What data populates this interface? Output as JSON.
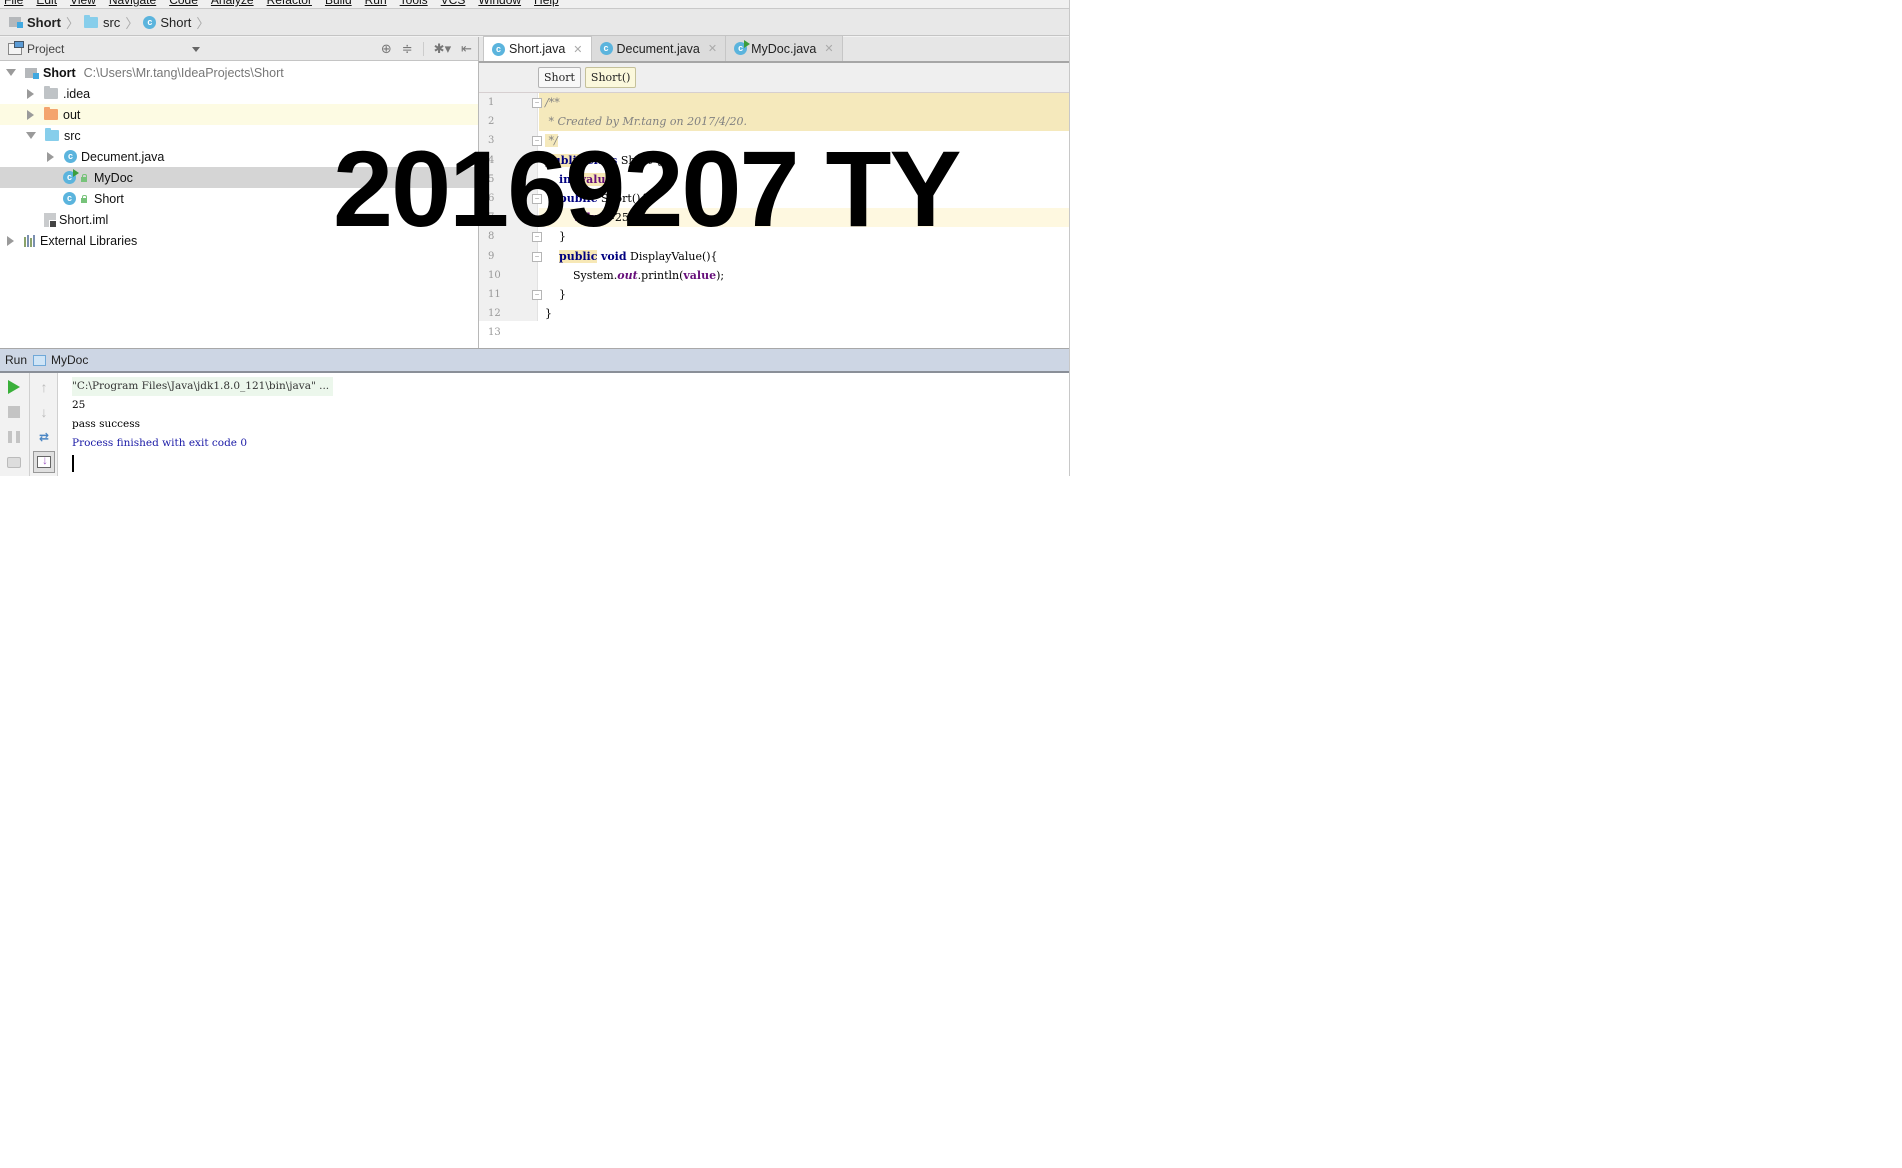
{
  "menu": [
    "File",
    "Edit",
    "View",
    "Navigate",
    "Code",
    "Analyze",
    "Refactor",
    "Build",
    "Run",
    "Tools",
    "VCS",
    "Window",
    "Help"
  ],
  "breadcrumb": [
    {
      "label": "Short",
      "icon": "module-icon"
    },
    {
      "label": "src",
      "icon": "folder-icon"
    },
    {
      "label": "Short",
      "icon": "class-icon"
    }
  ],
  "project_panel": {
    "title": "Project",
    "toolbar_icons": [
      "locate-icon",
      "collapse-all-icon",
      "settings-icon",
      "hide-panel-icon"
    ],
    "tree": [
      {
        "label": "Short",
        "hint": "C:\\Users\\Mr.tang\\IdeaProjects\\Short",
        "icon": "module-icon",
        "expanded": true
      },
      {
        "label": ".idea",
        "icon": "folder-icon",
        "expanded": false
      },
      {
        "label": "out",
        "icon": "folder-excluded-icon",
        "expanded": false
      },
      {
        "label": "src",
        "icon": "source-folder-icon",
        "expanded": true
      },
      {
        "label": "Decument.java",
        "icon": "class-icon",
        "expanded": false
      },
      {
        "label": "MyDoc",
        "icon": "runnable-class-icon",
        "selected": true
      },
      {
        "label": "Short",
        "icon": "class-icon"
      },
      {
        "label": "Short.iml",
        "icon": "iml-file-icon"
      },
      {
        "label": "External Libraries",
        "icon": "libraries-icon",
        "expanded": false
      }
    ]
  },
  "editor": {
    "tabs": [
      {
        "label": "Short.java",
        "active": true
      },
      {
        "label": "Decument.java",
        "active": false
      },
      {
        "label": "MyDoc.java",
        "active": false
      }
    ],
    "nav": [
      "Short",
      "Short()"
    ],
    "line_numbers": [
      "1",
      "2",
      "3",
      "4",
      "5",
      "6",
      "7",
      "8",
      "9",
      "10",
      "11",
      "12",
      "13"
    ],
    "code": {
      "l1": "/**",
      "l2": " * Created by Mr.tang on 2017/4/20.",
      "l3": " */",
      "l4_kw1": "public",
      "l4_kw2": "class",
      "l4_rest": " Short {",
      "l5_kw": "int",
      "l5_field": "value",
      "l5_rest": ";",
      "l6_kw": "public",
      "l6_rest": " Short(){",
      "l7_field": "value",
      "l7_rest": "=25;",
      "l8": "}",
      "l9_kw1": "public",
      "l9_kw2": "void",
      "l9_rest": " DisplayValue(){",
      "l10_a": "System.",
      "l10_static": "out",
      "l10_b": ".println(",
      "l10_field": "value",
      "l10_c": ");",
      "l11": "}",
      "l12": "}"
    }
  },
  "run_panel": {
    "title": "Run",
    "config": "MyDoc",
    "console": {
      "command": "\"C:\\Program Files\\Java\\jdk1.8.0_121\\bin\\java\" ...",
      "output": [
        "25",
        "pass success"
      ],
      "exit": "Process finished with exit code 0"
    }
  },
  "watermark": "20169207 TY"
}
